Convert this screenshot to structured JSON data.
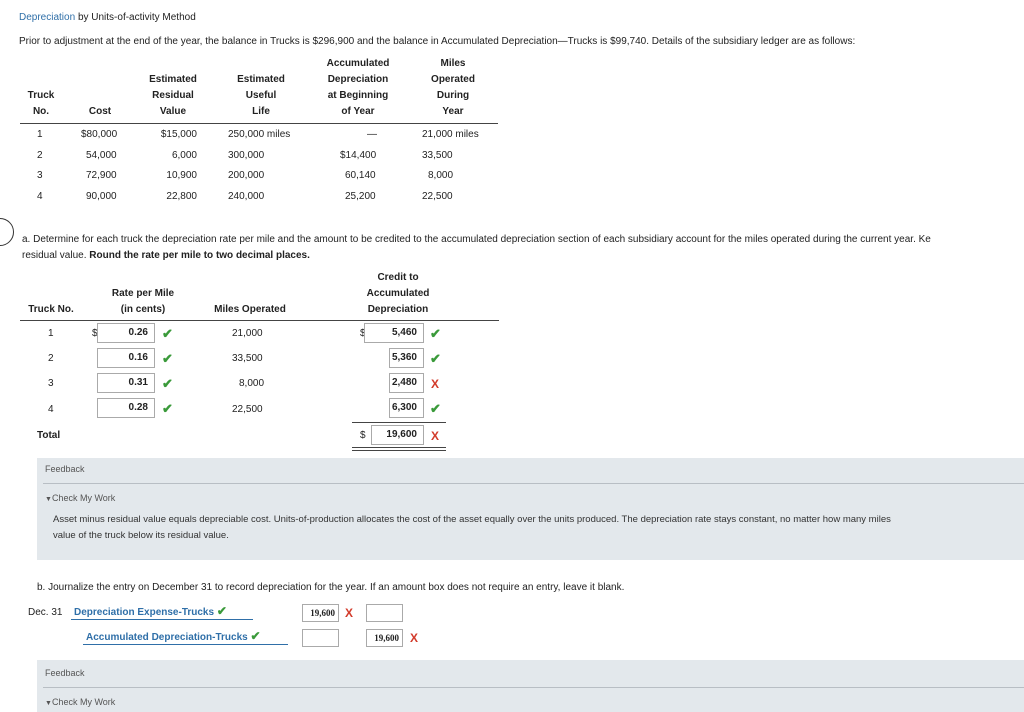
{
  "title": {
    "link": "Depreciation",
    "rest": "by Units-of-activity Method"
  },
  "intro": "Prior to adjustment at the end of the year, the balance in Trucks is $296,900 and the balance in Accumulated Depreciation—Trucks is $99,740. Details of the subsidiary ledger are as follows:",
  "ledger": {
    "headers": {
      "truck": [
        "Truck",
        "No."
      ],
      "cost": [
        "Cost"
      ],
      "residual": [
        "Estimated",
        "Residual",
        "Value"
      ],
      "life": [
        "Estimated",
        "Useful",
        "Life"
      ],
      "accum": [
        "Accumulated",
        "Depreciation",
        "at Beginning",
        "of Year"
      ],
      "miles": [
        "Miles",
        "Operated",
        "During",
        "Year"
      ]
    },
    "rows": [
      {
        "no": "1",
        "cost": "$80,000",
        "residual": "$15,000",
        "life": "250,000 miles",
        "accum": "—",
        "miles": "21,000 miles"
      },
      {
        "no": "2",
        "cost": "54,000",
        "residual": "6,000",
        "life": "300,000",
        "accum": "$14,400",
        "miles": "33,500"
      },
      {
        "no": "3",
        "cost": "72,900",
        "residual": "10,900",
        "life": "200,000",
        "accum": "60,140",
        "miles": "8,000"
      },
      {
        "no": "4",
        "cost": "90,000",
        "residual": "22,800",
        "life": "240,000",
        "accum": "25,200",
        "miles": "22,500"
      }
    ]
  },
  "partA": {
    "instructions": "a. Determine for each truck the depreciation rate per mile and the amount to be credited to the accumulated depreciation section of each subsidiary account for the miles operated during the current year. Ke",
    "instructions2_plain": "residual value.",
    "instructions2_bold": "Round the rate per mile to two decimal places.",
    "headers": {
      "truck": "Truck No.",
      "rate": [
        "Rate per Mile",
        "(in cents)"
      ],
      "miles": "Miles Operated",
      "credit": [
        "Credit to",
        "Accumulated",
        "Depreciation"
      ]
    },
    "currency": "$",
    "rows": [
      {
        "no": "1",
        "rate": "0.26",
        "miles": "21,000",
        "credit": "5,460",
        "rate_mark": "check",
        "credit_mark": "check"
      },
      {
        "no": "2",
        "rate": "0.16",
        "miles": "33,500",
        "credit": "5,360",
        "rate_mark": "check",
        "credit_mark": "check"
      },
      {
        "no": "3",
        "rate": "0.31",
        "miles": "8,000",
        "credit": "2,480",
        "rate_mark": "check",
        "credit_mark": "x"
      },
      {
        "no": "4",
        "rate": "0.28",
        "miles": "22,500",
        "credit": "6,300",
        "rate_mark": "check",
        "credit_mark": "check"
      }
    ],
    "total_label": "Total",
    "total_value": "19,600",
    "total_mark": "x"
  },
  "feedback1": {
    "label": "Feedback",
    "check_label": "Check My Work",
    "text1": "Asset minus residual value equals depreciable cost. Units-of-production allocates the cost of the asset equally over the units produced. The depreciation rate stays constant, no matter how many miles",
    "text2": "value of the truck below its residual value."
  },
  "partB": {
    "instructions": "b. Journalize the entry on December 31 to record depreciation for the year. If an amount box does not require an entry, leave it blank.",
    "date": "Dec. 31",
    "debit_account": "Depreciation Expense-Trucks",
    "debit_amount": "19,600",
    "credit_account": "Accumulated Depreciation-Trucks",
    "credit_amount": "19,600"
  },
  "feedback2": {
    "label": "Feedback",
    "check_label": "Check My Work"
  },
  "marks": {
    "check": "✔",
    "x": "X"
  },
  "icons": {
    "check": "check-icon",
    "x": "x-mark-icon",
    "triangle": "triangle-down-icon"
  },
  "colors": {
    "link": "#2f6fa8",
    "correct": "#3a9a3a",
    "incorrect": "#d23a2a",
    "feedback_bg": "#e3e8ec"
  }
}
